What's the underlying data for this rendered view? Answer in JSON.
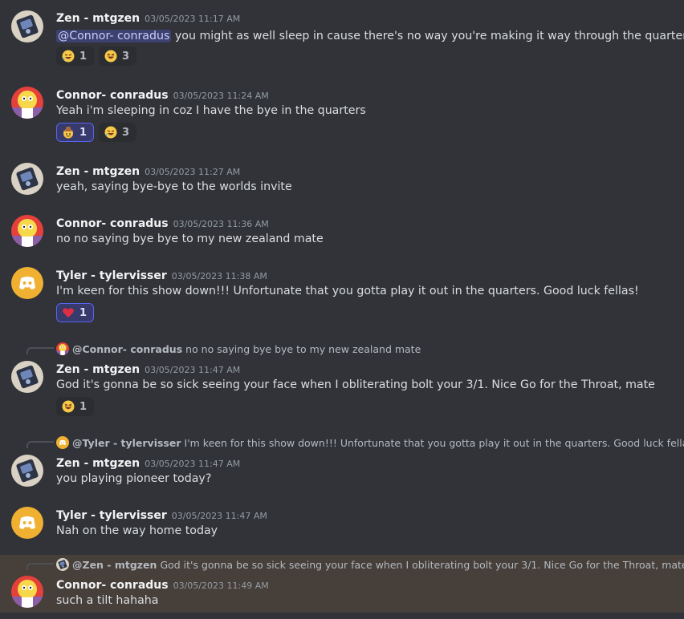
{
  "messages": [
    {
      "author": "Zen - mtgzen",
      "time": "03/05/2023 11:17 AM",
      "mention": "@Connor- conradus",
      "text": " you might as well sleep in cause there's no way you're making it way through the quarters",
      "reactions": [
        {
          "emoji": "rofl",
          "count": "1"
        },
        {
          "emoji": "laughing",
          "count": "3"
        }
      ]
    },
    {
      "author": "Connor- conradus",
      "time": "03/05/2023 11:24 AM",
      "text": "Yeah i'm sleeping in coz I have the bye in the quarters",
      "reactions": [
        {
          "emoji": "cowboy",
          "count": "1"
        },
        {
          "emoji": "rofl",
          "count": "3"
        }
      ]
    },
    {
      "author": "Zen - mtgzen",
      "time": "03/05/2023 11:27 AM",
      "text": "yeah, saying bye-bye to the worlds invite"
    },
    {
      "author": "Connor- conradus",
      "time": "03/05/2023 11:36 AM",
      "text": "no no saying bye bye to my new zealand mate"
    },
    {
      "author": "Tyler - tylervisser",
      "time": "03/05/2023 11:38 AM",
      "text": "I'm keen for this show down!!! Unfortunate that you gotta play it out in the quarters. Good luck fellas!",
      "reactions": [
        {
          "emoji": "heart",
          "count": "1"
        }
      ]
    },
    {
      "reply": {
        "name": "@Connor- conradus",
        "text": "no no saying bye bye to my new zealand mate"
      },
      "author": "Zen - mtgzen",
      "time": "03/05/2023 11:47 AM",
      "text": "God it's gonna be so sick seeing your face when I obliterating bolt your 3/1. Nice Go for the Throat, mate",
      "reactions": [
        {
          "emoji": "laughing",
          "count": "1"
        }
      ]
    },
    {
      "reply": {
        "name": "@Tyler - tylervisser",
        "text": "I'm keen for this show down!!! Unfortunate that you gotta play it out in the quarters. Good luck fellas!"
      },
      "author": "Zen - mtgzen",
      "time": "03/05/2023 11:47 AM",
      "text": "you playing pioneer today?"
    },
    {
      "author": "Tyler - tylervisser",
      "time": "03/05/2023 11:47 AM",
      "text": "Nah on the way home today"
    },
    {
      "reply": {
        "name": "@Zen - mtgzen",
        "text": "God it's gonna be so sick seeing your face when I obliterating bolt your 3/1. Nice Go for the Throat, mate"
      },
      "author": "Connor- conradus",
      "time": "03/05/2023 11:49 AM",
      "text": "such a tilt hahaha"
    }
  ],
  "colors": {
    "background": "#313338",
    "highlight": "#463f3a",
    "mention_bg": "#3c4270",
    "discord_blurple": "#5865f2",
    "tyler_avatar": "#f0b132"
  }
}
